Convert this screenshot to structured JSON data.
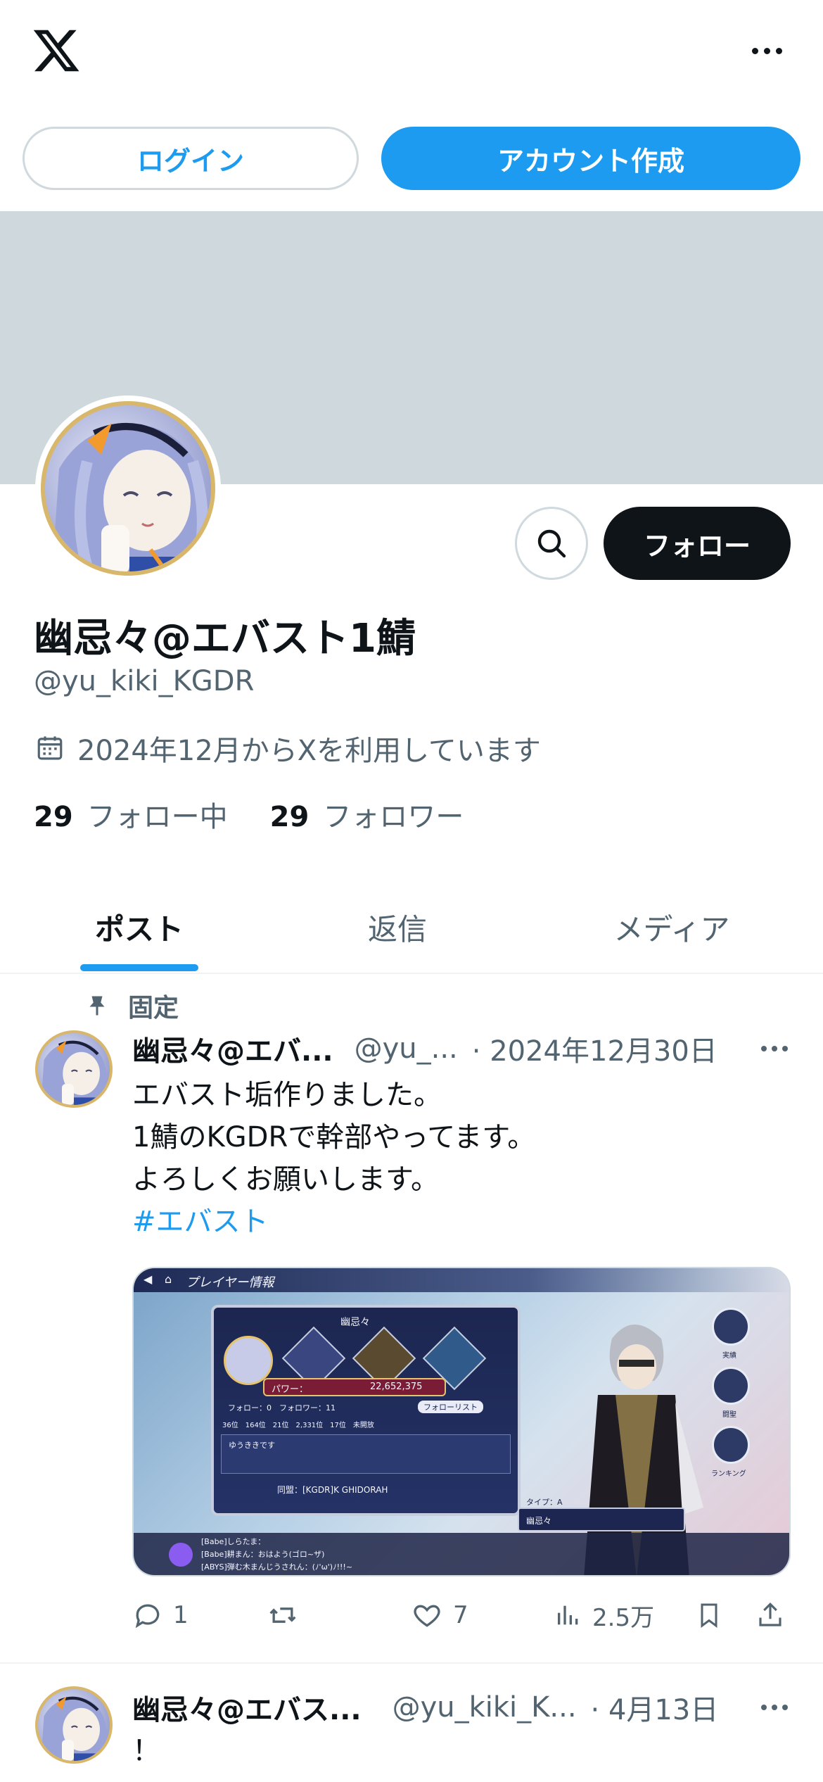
{
  "header": {
    "logo": "x-logo",
    "more": "more-icon"
  },
  "auth": {
    "login_label": "ログイン",
    "signup_label": "アカウント作成"
  },
  "profile": {
    "display_name": "幽忌々@エバスト1鯖",
    "handle": "@yu_kiki_KGDR",
    "joined": "2024年12月からXを利用しています",
    "following_count": "29",
    "following_label": "フォロー中",
    "followers_count": "29",
    "followers_label": "フォロワー",
    "follow_label": "フォロー"
  },
  "tabs": [
    {
      "label": "ポスト",
      "active": true
    },
    {
      "label": "返信",
      "active": false
    },
    {
      "label": "メディア",
      "active": false
    }
  ],
  "posts": [
    {
      "pinned_label": "固定",
      "name": "幽忌々@エバ...",
      "handle": "@yu_...",
      "date": "· 2024年12月30日",
      "lines": [
        "エバスト垢作りました。",
        "1鯖のKGDRで幹部やってます。",
        "よろしくお願いします。"
      ],
      "hashtag": "#エバスト",
      "media": {
        "header_title": "プレイヤー情報",
        "player_name": "幽忌々",
        "power_label": "パワー：",
        "power_value": "22,652,375",
        "follow_stats": "フォロー：0　フォロワー：11",
        "follow_list": "フォローリスト",
        "ranks": "36位　164位　21位　2,331位　17位　未開放",
        "bio": "ゆうききです",
        "guild": "同盟：[KGDR]K GHIDORAH",
        "side_labels": [
          "実績",
          "闘聖",
          "ランキング"
        ],
        "type_label": "タイプ：A",
        "char_name": "幽忌々",
        "chat_lines": [
          "[Babe]しらたま：",
          "[Babe]耕まん：おはよう(ゴロ~ザ)",
          "[ABYS]弾む木まんじうされん：(ﾉ'ω')ﾉ!!!~"
        ]
      },
      "replies": "1",
      "reposts": "",
      "likes": "7",
      "views": "2.5万"
    },
    {
      "name": "幽忌々@エバス...",
      "handle": "@yu_kiki_K...",
      "date": "· 4月13日",
      "text": "！"
    }
  ],
  "colors": {
    "accent": "#1d9bf0",
    "text": "#0f1419",
    "muted": "#536471",
    "banner": "#cfd9dd"
  }
}
